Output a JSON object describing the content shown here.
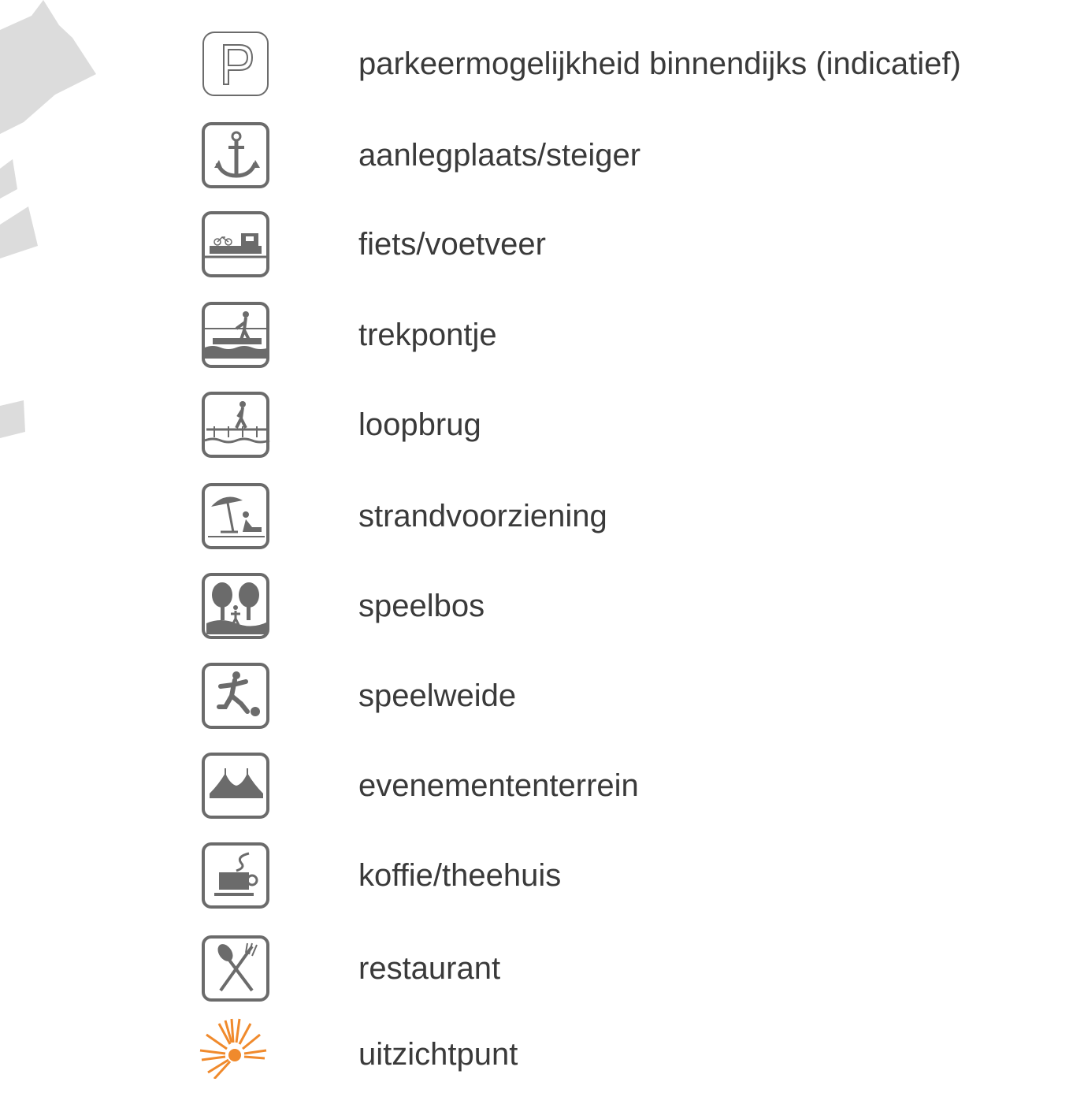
{
  "legend": {
    "items": [
      {
        "label": "parkeermogelijkheid binnendijks (indicatief)",
        "icon": "parking-icon"
      },
      {
        "label": "aanlegplaats/steiger",
        "icon": "anchor-icon"
      },
      {
        "label": "fiets/voetveer",
        "icon": "bike-ferry-icon"
      },
      {
        "label": "trekpontje",
        "icon": "pull-ferry-icon"
      },
      {
        "label": "loopbrug",
        "icon": "footbridge-icon"
      },
      {
        "label": "strandvoorziening",
        "icon": "beach-icon"
      },
      {
        "label": "speelbos",
        "icon": "play-forest-icon"
      },
      {
        "label": "speelweide",
        "icon": "play-field-icon"
      },
      {
        "label": "evenemententerrein",
        "icon": "event-tent-icon"
      },
      {
        "label": "koffie/theehuis",
        "icon": "coffee-cup-icon"
      },
      {
        "label": "restaurant",
        "icon": "spoon-fork-icon"
      },
      {
        "label": "uitzichtpunt",
        "icon": "sun-viewpoint-icon"
      }
    ]
  },
  "colors": {
    "icon_gray": "#6b6b6b",
    "text": "#3a3a3a",
    "map_fragment": "#dcdcdc",
    "viewpoint_orange": "#f08a2c"
  }
}
